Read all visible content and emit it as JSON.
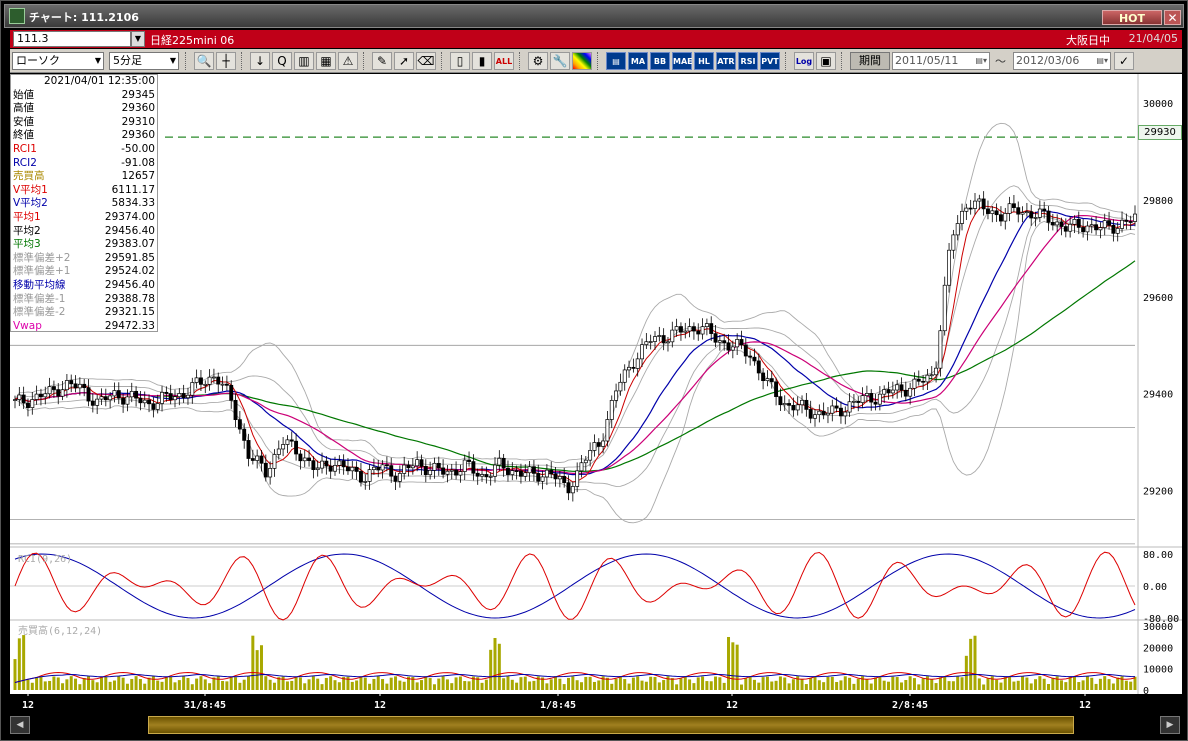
{
  "window": {
    "title": "チャート: 111.2106",
    "hot_label": "HOT",
    "close_label": "✕"
  },
  "instrument": {
    "symbol": "111.3",
    "name": "日経225mini 06",
    "exchange": "大阪日中",
    "date": "21/04/05"
  },
  "toolbar": {
    "chart_type": "ローソク",
    "interval": "5分足",
    "buttons": [
      "MA",
      "BB",
      "MAE",
      "HL",
      "ATR",
      "RSI",
      "PVT",
      "Log"
    ],
    "period_label": "期間",
    "date_from": "2011/05/11",
    "date_to": "2012/03/06",
    "tilde": "〜"
  },
  "infobox": {
    "datetime": "2021/04/01  12:35:00",
    "rows": [
      {
        "k": "始値",
        "v": "29345",
        "c": "#000"
      },
      {
        "k": "高値",
        "v": "29360",
        "c": "#000"
      },
      {
        "k": "安値",
        "v": "29310",
        "c": "#000"
      },
      {
        "k": "終値",
        "v": "29360",
        "c": "#000"
      },
      {
        "k": "RCI1",
        "v": "-50.00",
        "c": "#d00"
      },
      {
        "k": "RCI2",
        "v": "-91.08",
        "c": "#00a"
      },
      {
        "k": "売買高",
        "v": "12657",
        "c": "#a80"
      },
      {
        "k": "V平均1",
        "v": "6111.17",
        "c": "#d00"
      },
      {
        "k": "V平均2",
        "v": "5834.33",
        "c": "#00a"
      },
      {
        "k": "平均1",
        "v": "29374.00",
        "c": "#d00"
      },
      {
        "k": "平均2",
        "v": "29456.40",
        "c": "#000"
      },
      {
        "k": "平均3",
        "v": "29383.07",
        "c": "#070"
      },
      {
        "k": "標準偏差+2",
        "v": "29591.85",
        "c": "#999"
      },
      {
        "k": "標準偏差+1",
        "v": "29524.02",
        "c": "#999"
      },
      {
        "k": "移動平均線",
        "v": "29456.40",
        "c": "#00a"
      },
      {
        "k": "標準偏差-1",
        "v": "29388.78",
        "c": "#999"
      },
      {
        "k": "標準偏差-2",
        "v": "29321.15",
        "c": "#999"
      },
      {
        "k": "Vwap",
        "v": "29472.33",
        "c": "#d0a"
      }
    ]
  },
  "price_axis": {
    "labels": [
      "30000",
      "29800",
      "29600",
      "29400",
      "29200"
    ],
    "current": "29930"
  },
  "rci_panel": {
    "label": "RCI(9,26)",
    "labels": [
      "80.00",
      "0.00",
      "-80.00"
    ]
  },
  "volume_panel": {
    "label": "売買高(6,12,24)",
    "labels": [
      "30000",
      "20000",
      "10000",
      "0"
    ]
  },
  "time_axis": {
    "labels": [
      "12",
      "31/8:45",
      "12",
      "1/8:45",
      "12",
      "2/8:45",
      "12"
    ]
  },
  "colors": {
    "ma_fast": "#cc0000",
    "ma_mid": "#0000aa",
    "ma_slow": "#007700",
    "vwap": "#cc0077",
    "bands": "#aaaaaa",
    "volume": "#a8a800"
  },
  "chart_data": {
    "type": "candlestick",
    "interval": "5min",
    "close_approx": [
      29380,
      29390,
      29400,
      29420,
      29410,
      29380,
      29400,
      29390,
      29380,
      29390,
      29400,
      29420,
      29440,
      29380,
      29270,
      29240,
      29300,
      29280,
      29240,
      29260,
      29240,
      29230,
      29250,
      29230,
      29260,
      29240,
      29240,
      29250,
      29230,
      29250,
      29240,
      29230,
      29240,
      29200,
      29260,
      29300,
      29410,
      29470,
      29510,
      29520,
      29530,
      29540,
      29510,
      29500,
      29480,
      29420,
      29380,
      29370,
      29360,
      29360,
      29380,
      29390,
      29400,
      29410,
      29420,
      29440,
      29720,
      29800,
      29780,
      29770,
      29780,
      29770,
      29760,
      29740,
      29750,
      29740,
      29750,
      29760
    ],
    "current_price": 29930,
    "price_ylim": [
      29100,
      30050
    ]
  }
}
